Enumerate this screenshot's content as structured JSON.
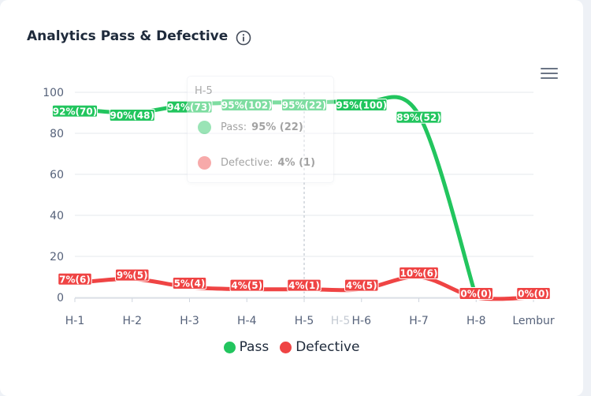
{
  "card": {
    "title": "Analytics Pass & Defective"
  },
  "colors": {
    "pass": "#22c55e",
    "defective": "#ef4444"
  },
  "icons": {
    "info": "info-icon",
    "menu": "hamburger-menu-icon"
  },
  "tooltip": {
    "title": "H-5",
    "rows": [
      {
        "name": "Pass:",
        "value": "95% (22)"
      },
      {
        "name": "Defective:",
        "value": "4% (1)"
      }
    ]
  },
  "crosshair_label": "H-5",
  "legend": [
    {
      "label": "Pass"
    },
    {
      "label": "Defective"
    }
  ],
  "chart_data": {
    "type": "line",
    "x": [
      "H-1",
      "H-2",
      "H-3",
      "H-4",
      "H-5",
      "H-6",
      "H-7",
      "H-8",
      "Lembur"
    ],
    "ylim": [
      0,
      100
    ],
    "yticks": [
      0,
      20,
      40,
      60,
      80,
      100
    ],
    "grid": true,
    "legend_position": "bottom",
    "series": [
      {
        "name": "Pass",
        "color": "#22c55e",
        "values": [
          92,
          90,
          94,
          95,
          95,
          95,
          89,
          0,
          null
        ],
        "labels": [
          "92%(70)",
          "90%(48)",
          "94%(73)",
          "95%(102)",
          "95%(22)",
          "95%(100)",
          "89%(52)",
          "0%(0)",
          "0%(0)"
        ]
      },
      {
        "name": "Defective",
        "color": "#ef4444",
        "values": [
          7,
          9,
          5,
          4,
          4,
          4,
          10,
          0,
          0
        ],
        "labels": [
          "7%(6)",
          "9%(5)",
          "5%(4)",
          "4%(5)",
          "4%(1)",
          "4%(5)",
          "10%(6)",
          "0%(0)",
          "0%(0)"
        ]
      }
    ]
  }
}
